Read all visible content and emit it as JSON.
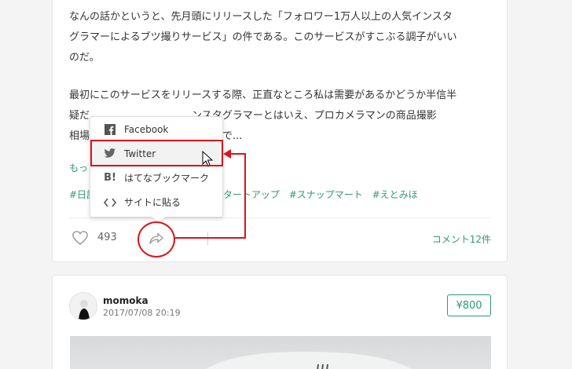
{
  "post": {
    "paragraph1": "なんの話かというと、先月頭にリリースした「フォロワー1万人以上の人気インスタ\nグラマーによるブツ撮りサービス」の件である。このサービスがすこぶる調子がいい\nのだ。",
    "paragraph2": "最初にこのサービスをリリースする際、正直なところ私は需要があるかどうか半信半\n疑だ　　　　　　　　　　ンスタグラマーとはいえ、プロカメラマンの商品撮影\n相場　　　　　　　　　　の単価で...",
    "read_more": "もっ",
    "tags": [
      "#日記",
      "スタートアップ",
      "#スナップマート",
      "#えとみほ"
    ],
    "like_count": "493",
    "comments_label": "コメント12件"
  },
  "share_menu": {
    "items": [
      {
        "label": "Facebook",
        "icon": "facebook-icon"
      },
      {
        "label": "Twitter",
        "icon": "twitter-icon"
      },
      {
        "label": "はてなブックマーク",
        "icon": "hatena-bookmark-icon"
      },
      {
        "label": "サイトに貼る",
        "icon": "embed-code-icon"
      }
    ]
  },
  "next_post": {
    "author": "momoka",
    "date": "2017/07/08 20:19",
    "price": "¥800"
  },
  "colors": {
    "accent": "#2f9a72",
    "annotation_red": "#d9141c"
  }
}
